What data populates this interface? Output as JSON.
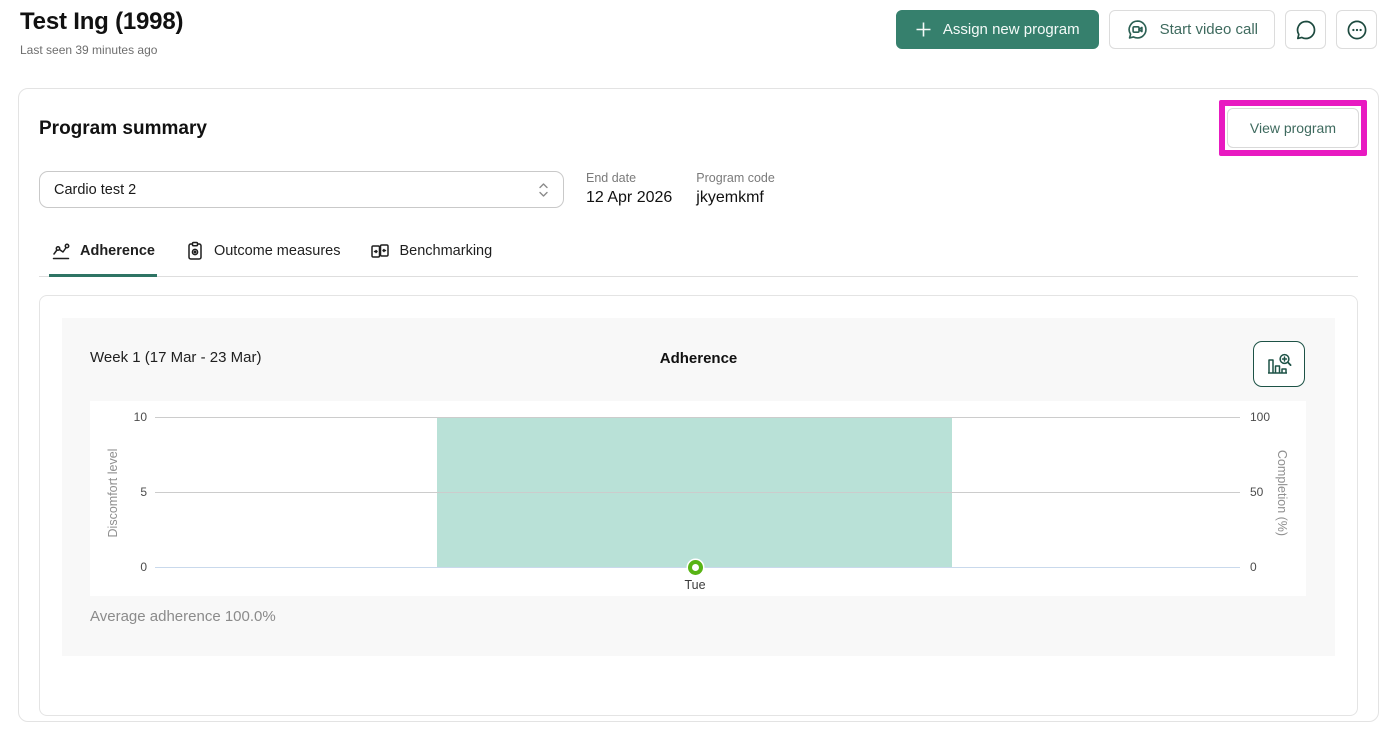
{
  "header": {
    "patient_name": "Test Ing (1998)",
    "last_seen": "Last seen 39 minutes ago",
    "actions": {
      "assign_new_program": "Assign new program",
      "start_video_call": "Start video call"
    }
  },
  "program_summary": {
    "title": "Program summary",
    "view_program": "View program",
    "program_select_value": "Cardio test 2",
    "end_date_label": "End date",
    "end_date_value": "12 Apr 2026",
    "program_code_label": "Program code",
    "program_code_value": "jkyemkmf",
    "tabs": [
      {
        "label": "Adherence",
        "active": true
      },
      {
        "label": "Outcome measures",
        "active": false
      },
      {
        "label": "Benchmarking",
        "active": false
      }
    ]
  },
  "chart": {
    "week_label": "Week 1 (17 Mar - 23 Mar)",
    "title": "Adherence",
    "average_adherence": "Average adherence 100.0%",
    "left_axis_label": "Discomfort level",
    "right_axis_label": "Completion (%)",
    "left_ticks": [
      "10",
      "5",
      "0"
    ],
    "right_ticks": [
      "100",
      "50",
      "0"
    ],
    "x_ticks": [
      "Tue"
    ]
  },
  "chart_data": {
    "type": "bar",
    "title": "Adherence",
    "categories": [
      "Tue"
    ],
    "series": [
      {
        "name": "Completion (%)",
        "type": "bar",
        "axis": "right",
        "values": [
          100
        ],
        "color": "#b9e1d7"
      },
      {
        "name": "Discomfort level",
        "type": "scatter",
        "axis": "left",
        "values": [
          0
        ],
        "color": "#58b414"
      }
    ],
    "left_axis": {
      "label": "Discomfort level",
      "range": [
        0,
        10
      ],
      "ticks": [
        0,
        5,
        10
      ]
    },
    "right_axis": {
      "label": "Completion (%)",
      "range": [
        0,
        100
      ],
      "ticks": [
        0,
        50,
        100
      ]
    },
    "grid": true,
    "annotation": "Average adherence 100.0%"
  },
  "colors": {
    "primary_button": "#36806d",
    "accent_teal_dark": "#1d5246",
    "link_teal": "#3e6a5e",
    "tab_underline": "#2e7464",
    "bar_fill": "#b9e1d7",
    "marker_green": "#58b414",
    "annotation_magenta": "#e81ac1",
    "card_gray": "#f8f8f8",
    "muted_text": "#7a7a7a"
  }
}
